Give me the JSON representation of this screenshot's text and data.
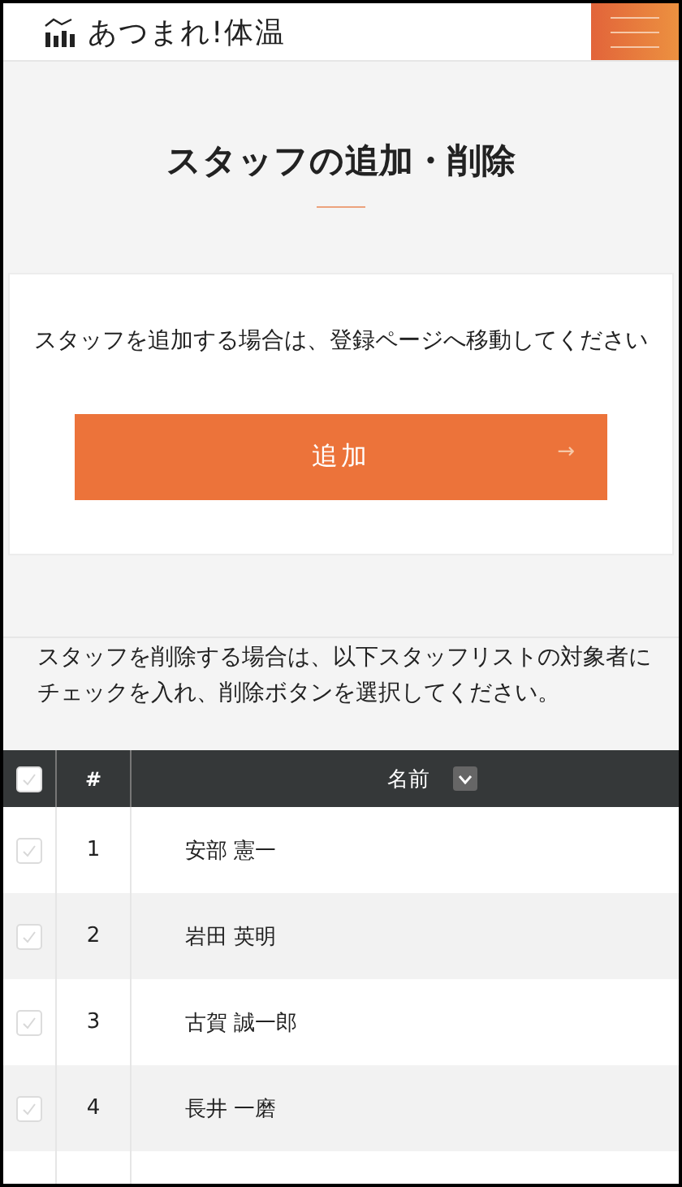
{
  "header": {
    "logo_text": "あつまれ!体温"
  },
  "page_title": "スタッフの追加・削除",
  "add_section": {
    "instruction": "スタッフを追加する場合は、登録ページへ移動してください",
    "button_label": "追加",
    "button_arrow": "→"
  },
  "delete_section": {
    "instruction": "スタッフを削除する場合は、以下スタッフリストの対象者にチェックを入れ、削除ボタンを選択してください。"
  },
  "table": {
    "select_all_checked": false,
    "columns": [
      "#",
      "名前"
    ],
    "rows": [
      {
        "number": "1",
        "name": "安部 憲一",
        "checked": false
      },
      {
        "number": "2",
        "name": "岩田 英明",
        "checked": false
      },
      {
        "number": "3",
        "name": "古賀 誠一郎",
        "checked": false
      },
      {
        "number": "4",
        "name": "長井 一磨",
        "checked": false
      }
    ]
  }
}
